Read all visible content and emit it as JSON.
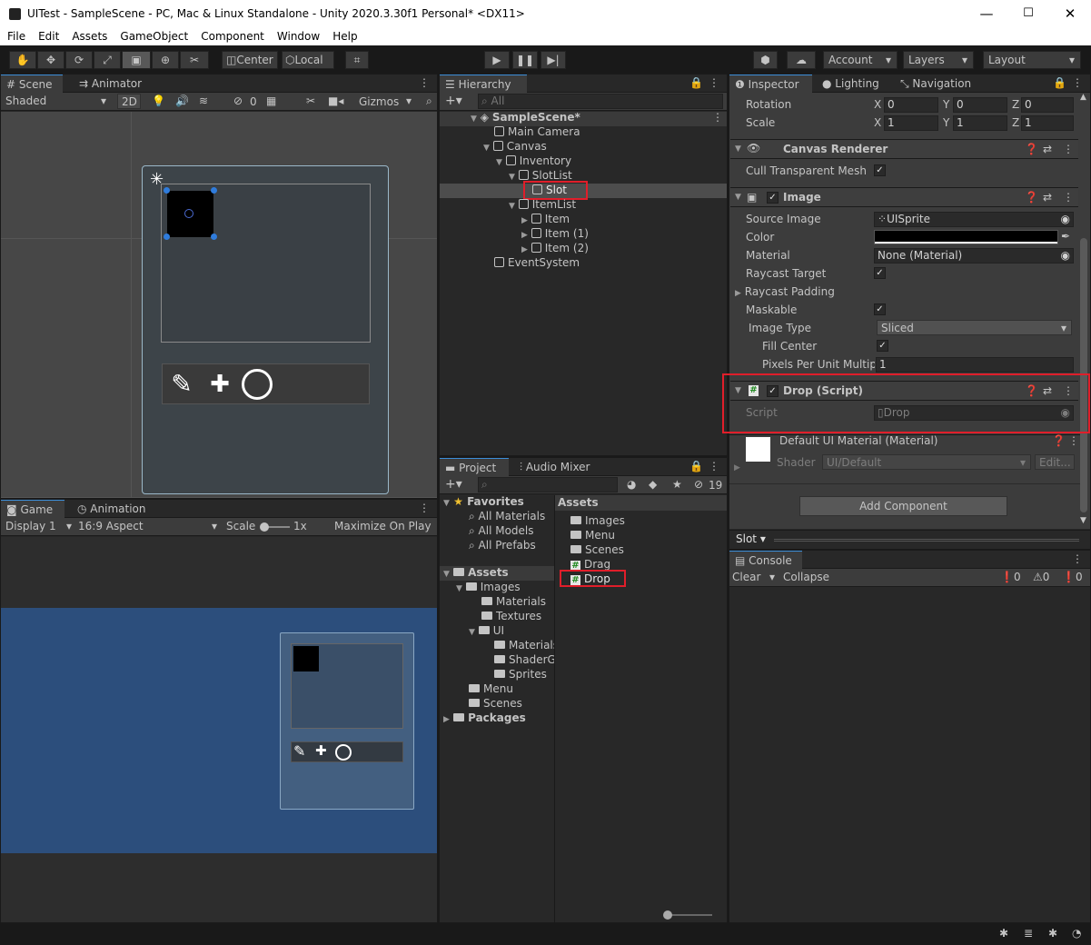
{
  "window": {
    "title": "UITest - SampleScene - PC, Mac & Linux Standalone - Unity 2020.3.30f1 Personal* <DX11>",
    "min": "—",
    "max": "☐",
    "close": "✕"
  },
  "menu": [
    "File",
    "Edit",
    "Assets",
    "GameObject",
    "Component",
    "Window",
    "Help"
  ],
  "toolbar": {
    "center": "Center",
    "local": "Local",
    "account": "Account",
    "layers": "Layers",
    "layout": "Layout"
  },
  "scene": {
    "tab_scene": "Scene",
    "tab_animator": "Animator",
    "shaded": "Shaded",
    "mode2d": "2D",
    "hidden_count": "0",
    "gizmos": "Gizmos"
  },
  "game": {
    "tab_game": "Game",
    "tab_animation": "Animation",
    "display": "Display 1",
    "aspect": "16:9 Aspect",
    "scale_label": "Scale",
    "scale_value": "1x",
    "maximize": "Maximize On Play"
  },
  "hierarchy": {
    "tab": "Hierarchy",
    "search_placeholder": "All",
    "items": [
      {
        "label": "SampleScene*"
      },
      {
        "label": "Main Camera"
      },
      {
        "label": "Canvas"
      },
      {
        "label": "Inventory"
      },
      {
        "label": "SlotList"
      },
      {
        "label": "Slot"
      },
      {
        "label": "ItemList"
      },
      {
        "label": "Item"
      },
      {
        "label": "Item (1)"
      },
      {
        "label": "Item (2)"
      },
      {
        "label": "EventSystem"
      }
    ]
  },
  "project": {
    "tab_project": "Project",
    "tab_audio": "Audio Mixer",
    "badge": "19",
    "favorites": "Favorites",
    "fav_items": [
      "All Materials",
      "All Models",
      "All Prefabs"
    ],
    "assets_root": "Assets",
    "tree": [
      {
        "label": "Images"
      },
      {
        "label": "Materials"
      },
      {
        "label": "Textures"
      },
      {
        "label": "UI"
      },
      {
        "label": "Materials"
      },
      {
        "label": "ShaderG"
      },
      {
        "label": "Sprites"
      },
      {
        "label": "Menu"
      },
      {
        "label": "Scenes"
      },
      {
        "label": "Packages"
      }
    ],
    "assets_header": "Assets",
    "assets": [
      {
        "label": "Images"
      },
      {
        "label": "Menu"
      },
      {
        "label": "Scenes"
      },
      {
        "label": "Drag"
      },
      {
        "label": "Drop"
      }
    ]
  },
  "inspector": {
    "tab_inspector": "Inspector",
    "tab_lighting": "Lighting",
    "tab_navigation": "Navigation",
    "rotation": {
      "label": "Rotation",
      "x": "0",
      "y": "0",
      "z": "0"
    },
    "scale": {
      "label": "Scale",
      "x": "1",
      "y": "1",
      "z": "1"
    },
    "axis_x": "X",
    "axis_y": "Y",
    "axis_z": "Z",
    "canvas_renderer": "Canvas Renderer",
    "cull_mesh": "Cull Transparent Mesh",
    "image": "Image",
    "source_image": {
      "label": "Source Image",
      "value": "UISprite"
    },
    "color_label": "Color",
    "material": {
      "label": "Material",
      "value": "None (Material)"
    },
    "raycast_target": "Raycast Target",
    "raycast_padding": "Raycast Padding",
    "maskable": "Maskable",
    "image_type": {
      "label": "Image Type",
      "value": "Sliced"
    },
    "fill_center": "Fill Center",
    "ppu": {
      "label": "Pixels Per Unit Multipli",
      "value": "1"
    },
    "drop_script": "Drop (Script)",
    "script": {
      "label": "Script",
      "value": "Drop"
    },
    "default_mat": "Default UI Material (Material)",
    "shader": {
      "label": "Shader",
      "value": "UI/Default",
      "edit": "Edit..."
    },
    "add_component": "Add Component",
    "footer_label": "Slot"
  },
  "console": {
    "tab": "Console",
    "clear": "Clear",
    "collapse": "Collapse",
    "count_log": "0",
    "count_warn": "0",
    "count_err": "0"
  }
}
